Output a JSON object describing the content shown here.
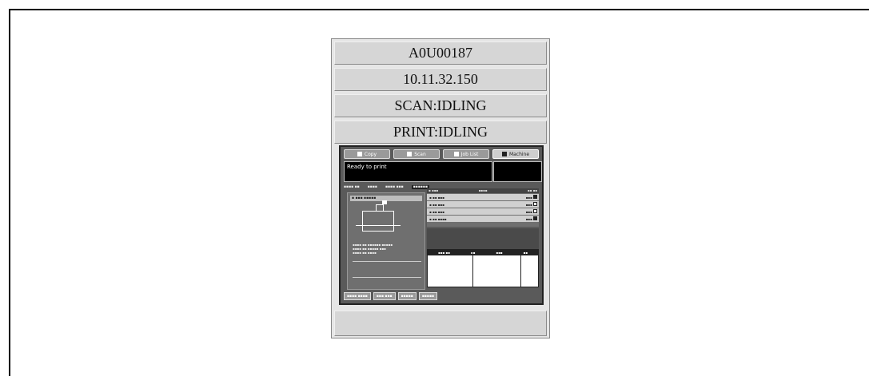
{
  "panel": {
    "model": "A0U00187",
    "ip_address": "10.11.32.150",
    "scan_status": "SCAN:IDLING",
    "print_status": "PRINT:IDLING",
    "footer": ""
  },
  "screen_thumbnail": {
    "tabs": [
      "Copy",
      "Scan",
      "Job List",
      "Machine"
    ],
    "message": "Ready to print"
  }
}
